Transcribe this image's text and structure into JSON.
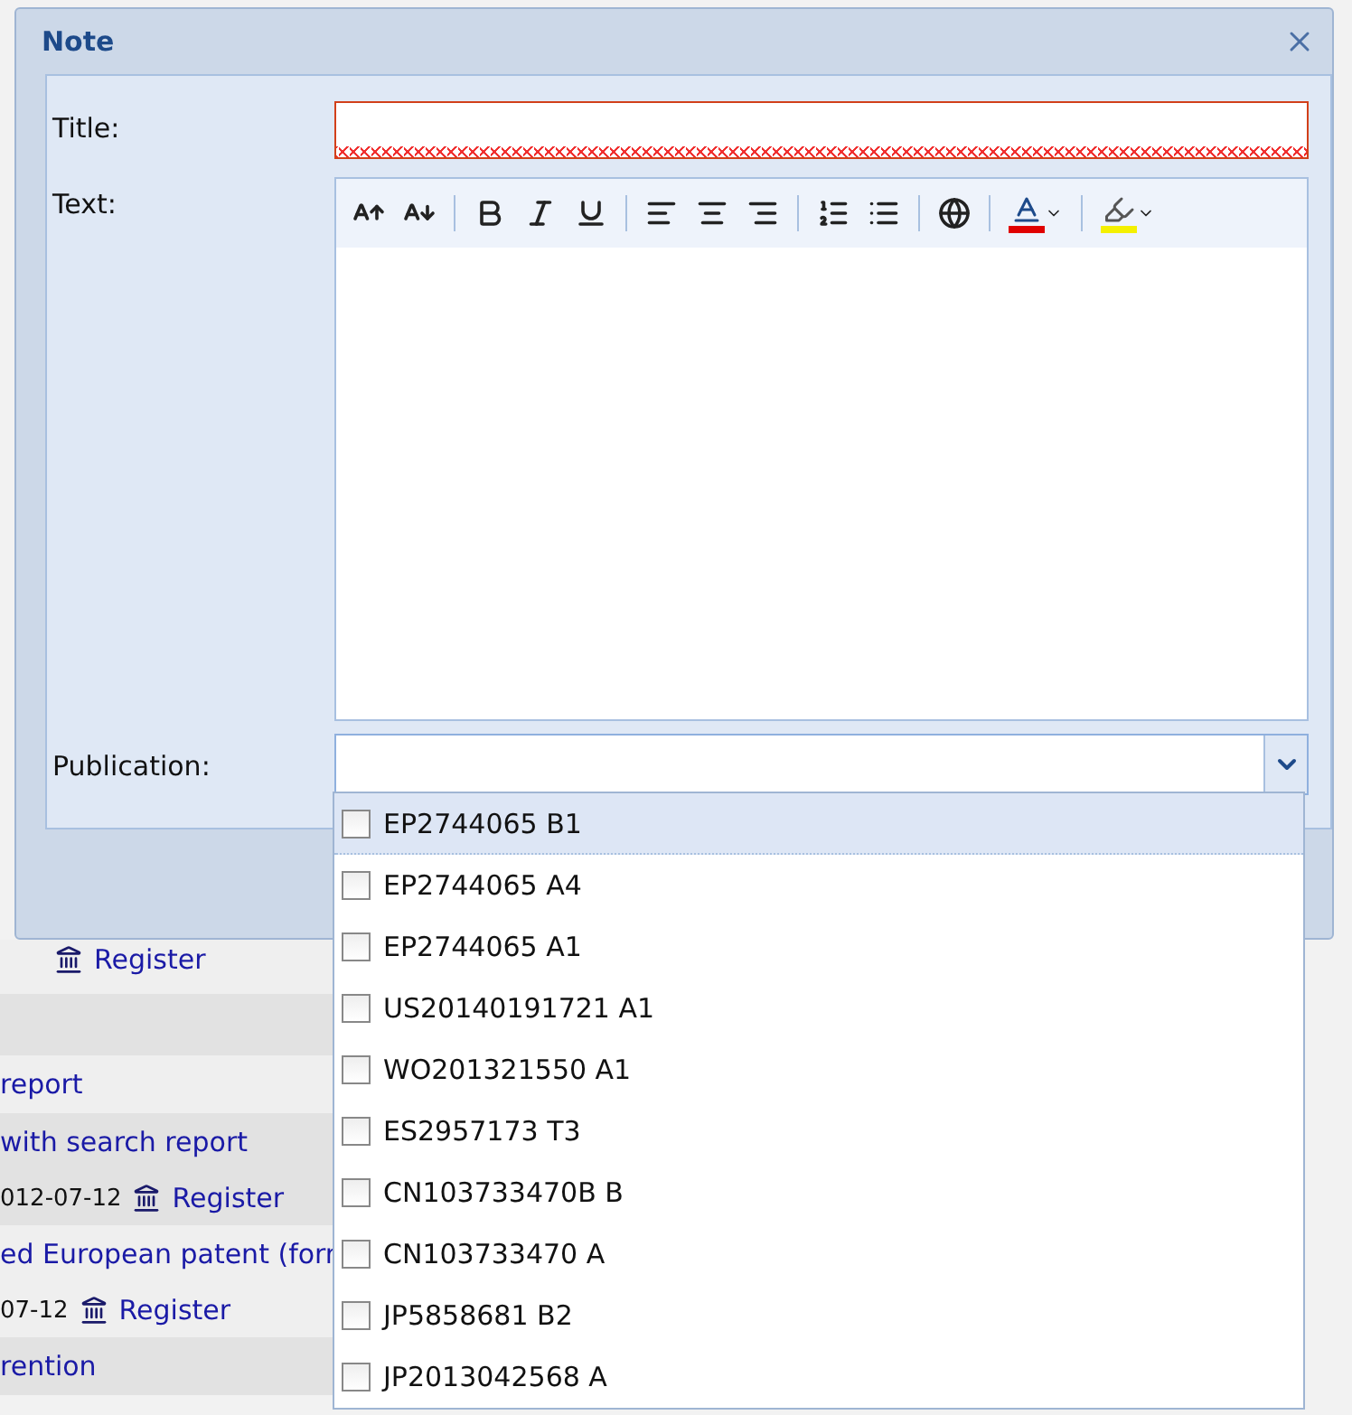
{
  "background": {
    "groups": [
      {
        "lines": [
          {
            "kind": "link",
            "text": "Register"
          }
        ]
      },
      {
        "kind": "blank"
      },
      {
        "lines": [
          {
            "kind": "title",
            "text": "report"
          }
        ]
      },
      {
        "lines": [
          {
            "kind": "title",
            "text": "with search report"
          },
          {
            "kind": "date",
            "date": "012-07-12",
            "text": "Register"
          }
        ]
      },
      {
        "lines": [
          {
            "kind": "title",
            "text": "ed European patent (forr"
          },
          {
            "kind": "date",
            "date": "07-12",
            "text": "Register"
          }
        ]
      },
      {
        "lines": [
          {
            "kind": "title",
            "text": "rention"
          }
        ]
      }
    ]
  },
  "dialog": {
    "title": "Note",
    "title_field": {
      "label": "Title:",
      "invalid": true
    },
    "text_field": {
      "label": "Text:"
    },
    "publication_field": {
      "label": "Publication:",
      "expanded": true,
      "options": [
        {
          "label": "EP2744065 B1",
          "checked": false,
          "selected": true
        },
        {
          "label": "EP2744065 A4",
          "checked": false,
          "selected": false
        },
        {
          "label": "EP2744065 A1",
          "checked": false,
          "selected": false
        },
        {
          "label": "US20140191721 A1",
          "checked": false,
          "selected": false
        },
        {
          "label": "WO201321550 A1",
          "checked": false,
          "selected": false
        },
        {
          "label": "ES2957173 T3",
          "checked": false,
          "selected": false
        },
        {
          "label": "CN103733470B B",
          "checked": false,
          "selected": false
        },
        {
          "label": "CN103733470 A",
          "checked": false,
          "selected": false
        },
        {
          "label": "JP5858681 B2",
          "checked": false,
          "selected": false
        },
        {
          "label": "JP2013042568 A",
          "checked": false,
          "selected": false
        }
      ]
    }
  }
}
